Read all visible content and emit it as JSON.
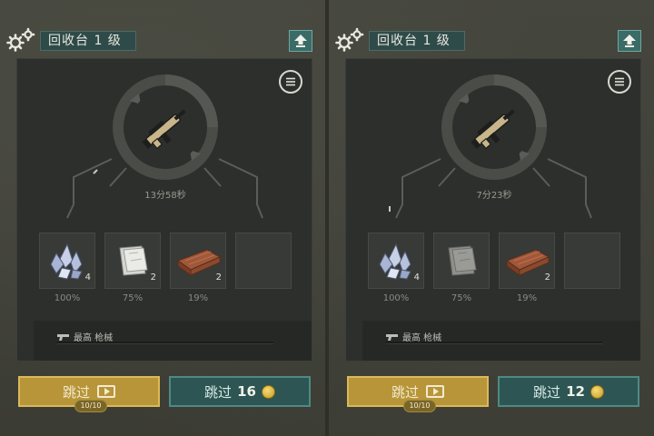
{
  "panels": [
    {
      "title": "回收台 1 级",
      "timer": "13分58秒",
      "slots": [
        {
          "icon": "crystal-icon",
          "count": "4",
          "pct": "100%"
        },
        {
          "icon": "cloth-icon",
          "count": "2",
          "pct": "75%"
        },
        {
          "icon": "plank-icon",
          "count": "2",
          "pct": "19%"
        },
        {
          "icon": "empty",
          "count": "",
          "pct": ""
        }
      ],
      "priority_label": "最高 枪械",
      "skip_ad_label": "跳过",
      "ad_counter": "10/10",
      "skip_coin_label": "跳过",
      "coin_cost": "16"
    },
    {
      "title": "回收台 1 级",
      "timer": "7分23秒",
      "slots": [
        {
          "icon": "crystal-icon",
          "count": "4",
          "pct": "100%"
        },
        {
          "icon": "cloth-icon",
          "count": "",
          "pct": "75%"
        },
        {
          "icon": "plank-icon",
          "count": "2",
          "pct": "19%"
        },
        {
          "icon": "empty",
          "count": "",
          "pct": ""
        }
      ],
      "priority_label": "最高 枪械",
      "skip_ad_label": "跳过",
      "ad_counter": "10/10",
      "skip_coin_label": "跳过",
      "coin_cost": "12"
    }
  ],
  "colors": {
    "ad_button": "#b79538",
    "coin_button": "#2d5553",
    "title_bg": "#2f4b49"
  }
}
